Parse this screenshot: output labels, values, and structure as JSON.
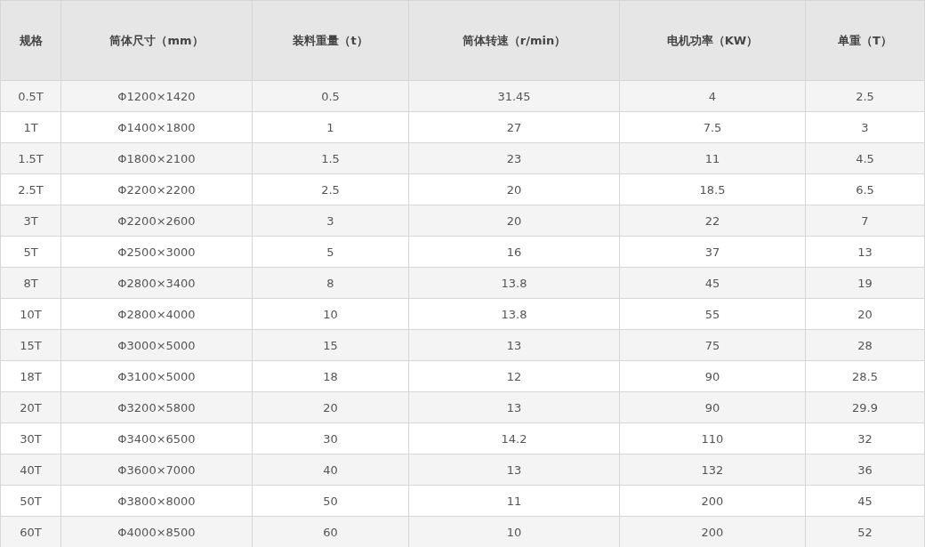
{
  "table": {
    "columns": [
      "规格",
      "筒体尺寸（mm）",
      "装料重量（t）",
      "筒体转速（r/min）",
      "电机功率（KW）",
      "单重（T）"
    ],
    "rows": [
      [
        "0.5T",
        "Φ1200×1420",
        "0.5",
        "31.45",
        "4",
        "2.5"
      ],
      [
        "1T",
        "Φ1400×1800",
        "1",
        "27",
        "7.5",
        "3"
      ],
      [
        "1.5T",
        "Φ1800×2100",
        "1.5",
        "23",
        "11",
        "4.5"
      ],
      [
        "2.5T",
        "Φ2200×2200",
        "2.5",
        "20",
        "18.5",
        "6.5"
      ],
      [
        "3T",
        "Φ2200×2600",
        "3",
        "20",
        "22",
        "7"
      ],
      [
        "5T",
        "Φ2500×3000",
        "5",
        "16",
        "37",
        "13"
      ],
      [
        "8T",
        "Φ2800×3400",
        "8",
        "13.8",
        "45",
        "19"
      ],
      [
        "10T",
        "Φ2800×4000",
        "10",
        "13.8",
        "55",
        "20"
      ],
      [
        "15T",
        "Φ3000×5000",
        "15",
        "13",
        "75",
        "28"
      ],
      [
        "18T",
        "Φ3100×5000",
        "18",
        "12",
        "90",
        "28.5"
      ],
      [
        "20T",
        "Φ3200×5800",
        "20",
        "13",
        "90",
        "29.9"
      ],
      [
        "30T",
        "Φ3400×6500",
        "30",
        "14.2",
        "110",
        "32"
      ],
      [
        "40T",
        "Φ3600×7000",
        "40",
        "13",
        "132",
        "36"
      ],
      [
        "50T",
        "Φ3800×8000",
        "50",
        "11",
        "200",
        "45"
      ],
      [
        "60T",
        "Φ4000×8500",
        "60",
        "10",
        "200",
        "52"
      ]
    ]
  }
}
